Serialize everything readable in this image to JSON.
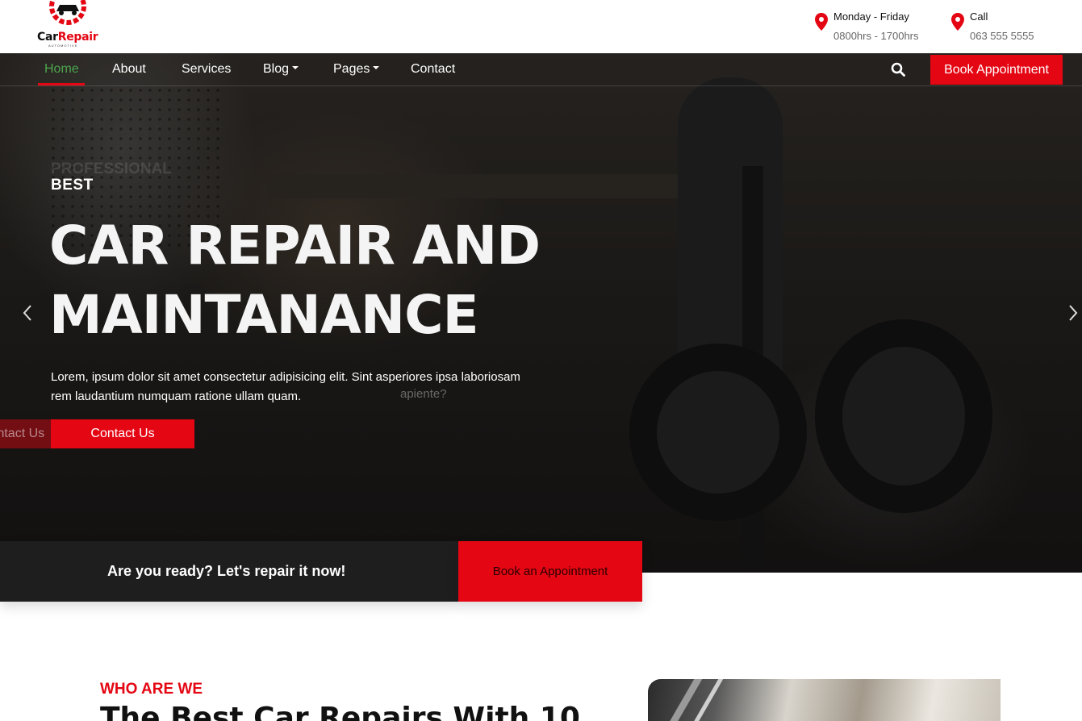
{
  "brand": {
    "name_part1": "Car",
    "name_part2": "Repair",
    "tagline": "AUTOMOTIVE"
  },
  "contact_info": [
    {
      "icon": "map-pin-icon",
      "line1": "Monday - Friday",
      "line2": "0800hrs - 1700hrs"
    },
    {
      "icon": "map-pin-icon",
      "line1": "Call",
      "line2": "063 555 5555"
    }
  ],
  "nav": {
    "items": [
      {
        "label": "Home",
        "active": true
      },
      {
        "label": "About"
      },
      {
        "label": "Services"
      },
      {
        "label": "Blog",
        "dropdown": true
      },
      {
        "label": "Pages",
        "dropdown": true
      },
      {
        "label": "Contact"
      }
    ],
    "search_icon": "search-icon",
    "book_label": "Book Appointment"
  },
  "hero": {
    "ghost_eyebrow": "PROFESSIONAL",
    "eyebrow": "BEST",
    "headline_line1": "CAR REPAIR AND",
    "headline_line2": "MAINTANANCE",
    "description": "Lorem, ipsum dolor sit amet consectetur adipisicing elit. Sint asperiores ipsa laboriosam rem laudantium numquam ratione ullam quam.",
    "ghost_desc_tail": "apiente?",
    "button_label": "Contact Us",
    "ghost_button_label": "Contact Us"
  },
  "cta": {
    "text": "Are you ready? Let's repair it now!",
    "button_label": "Book an Appointment"
  },
  "about": {
    "eyebrow": "WHO ARE WE",
    "title": "The Best Car Repairs With 10"
  },
  "colors": {
    "accent": "#e40613",
    "active_nav": "#4ca64c",
    "dark": "#1e1e1e"
  }
}
